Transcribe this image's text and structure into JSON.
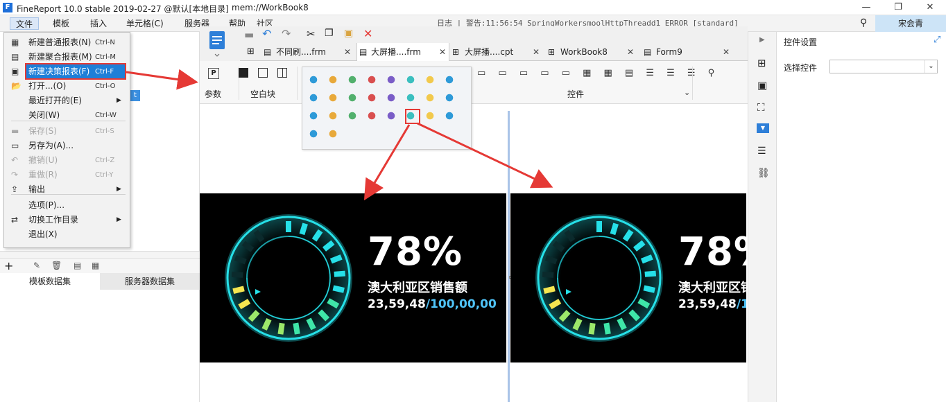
{
  "window": {
    "title": "FineReport 10.0 stable 2019-02-27 @默认[本地目录]",
    "path": "mem://WorkBook8",
    "buttons": [
      "—",
      "❐",
      "✕"
    ]
  },
  "menubar": {
    "items": [
      "文件",
      "模板",
      "插入",
      "单元格(C)",
      "服务器",
      "帮助",
      "社区"
    ],
    "log_text": "日志 | 警告:11:56:54 SpringWorkersmoolHttpThreadd1 ERROR [standard]",
    "user": "宋会青"
  },
  "file_menu": {
    "items": [
      {
        "label": "新建普通报表(N)",
        "shortcut": "Ctrl-N",
        "icon": "new-report-icon",
        "disabled": false
      },
      {
        "label": "新建聚合报表(M)",
        "shortcut": "Ctrl-M",
        "icon": "new-aggregate-icon",
        "disabled": false
      },
      {
        "label": "新建决策报表(F)",
        "shortcut": "Ctrl-F",
        "icon": "new-decision-icon",
        "disabled": false,
        "highlighted": true
      },
      {
        "label": "打开...(O)",
        "shortcut": "Ctrl-O",
        "icon": "folder-icon",
        "disabled": false
      },
      {
        "label": "最近打开的(E)",
        "shortcut": "",
        "icon": "",
        "disabled": false,
        "submenu": true
      },
      {
        "label": "关闭(W)",
        "shortcut": "Ctrl-W",
        "icon": "",
        "disabled": false
      },
      {
        "label": "保存(S)",
        "shortcut": "Ctrl-S",
        "icon": "save-icon",
        "disabled": true
      },
      {
        "label": "另存为(A)...",
        "shortcut": "",
        "icon": "save-as-icon",
        "disabled": false
      },
      {
        "label": "撤销(U)",
        "shortcut": "Ctrl-Z",
        "icon": "undo-icon",
        "disabled": true
      },
      {
        "label": "重做(R)",
        "shortcut": "Ctrl-Y",
        "icon": "redo-icon",
        "disabled": true
      },
      {
        "label": "输出",
        "shortcut": "",
        "icon": "export-icon",
        "disabled": false,
        "submenu": true
      },
      {
        "label": "选项(P)...",
        "shortcut": "",
        "icon": "",
        "disabled": false
      },
      {
        "label": "切换工作目录",
        "shortcut": "",
        "icon": "switch-dir-icon",
        "disabled": false,
        "submenu": true
      },
      {
        "label": "退出(X)",
        "shortcut": "",
        "icon": "",
        "disabled": false
      }
    ]
  },
  "left_panel": {
    "tabs": [
      "模板数据集",
      "服务器数据集"
    ]
  },
  "tabs": [
    {
      "label": "不同刷....frm",
      "icon": "form-icon"
    },
    {
      "label": "大屏播....frm",
      "icon": "form-icon"
    },
    {
      "label": "大屏播....cpt",
      "icon": "grid-icon"
    },
    {
      "label": "WorkBook8",
      "icon": "grid-icon"
    },
    {
      "label": "Form9",
      "icon": "form-icon"
    }
  ],
  "ribbon": {
    "param_label": "参数",
    "blank_label": "空白块",
    "control_label": "控件"
  },
  "right_panel": {
    "title": "控件设置",
    "select_label": "选择控件"
  },
  "gauge": {
    "percent": "78%",
    "percent_value": 78,
    "region": "澳大利亚区销售额",
    "value": "23,59,48",
    "total": "/100,00,00"
  },
  "colors": {
    "highlight": "#1e7fd8",
    "annotation_red": "#e53935",
    "gauge_cyan": "#26e0e8",
    "gauge_yellow": "#f5e650"
  }
}
